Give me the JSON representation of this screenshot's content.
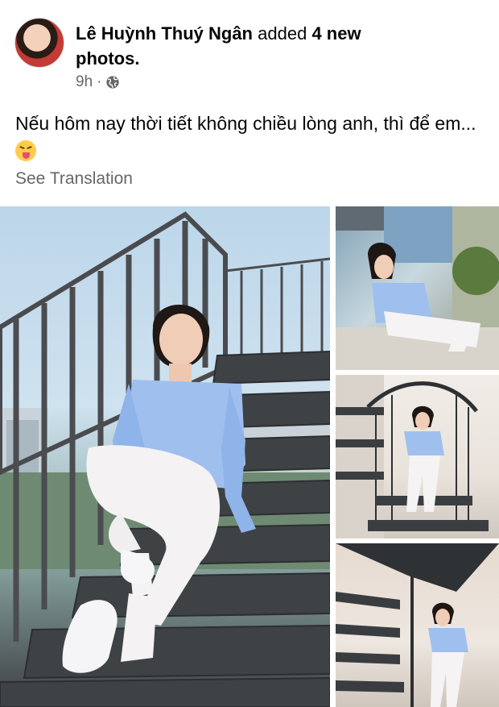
{
  "post": {
    "author": "Lê Huỳnh Thuý Ngân",
    "action": "added",
    "count_label": "4 new photos.",
    "timestamp": "9h",
    "separator": "·",
    "caption": "Nếu hôm nay thời tiết không chiều lòng anh, thì để em...",
    "see_translation": "See Translation"
  },
  "icons": {
    "audience": "globe-icon",
    "emoji": "squinting-face-with-tongue"
  },
  "colors": {
    "text_primary": "#050505",
    "text_secondary": "#65676b"
  },
  "photos": {
    "count": 4
  }
}
